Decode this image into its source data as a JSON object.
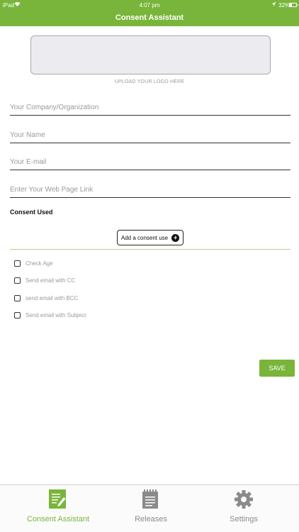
{
  "status_bar": {
    "carrier": "iPad",
    "time": "4:07 pm",
    "battery_text": "32%",
    "battery_level": 0.32
  },
  "header": {
    "title": "Consent Assistant"
  },
  "logo": {
    "hint": "UPLOAD YOUR LOGO HERE"
  },
  "form": {
    "company_placeholder": "Your Company/Organization",
    "name_placeholder": "Your Name",
    "email_placeholder": "Your E-mail",
    "link_placeholder": "Enter Your Web Page Link"
  },
  "consent": {
    "title": "Consent Used",
    "add_button": "Add a consent use",
    "options": [
      "Check Age",
      "Send email with CC",
      "send email with BCC",
      "Send email with Subject"
    ]
  },
  "save_label": "SAVE",
  "tabs": [
    {
      "label": "Consent Assistant",
      "icon": "document-edit-icon",
      "active": true
    },
    {
      "label": "Releases",
      "icon": "notepad-icon",
      "active": false
    },
    {
      "label": "Settings",
      "icon": "gear-icon",
      "active": false
    }
  ],
  "colors": {
    "accent": "#79b53a",
    "inactive": "#8a8a8a"
  }
}
